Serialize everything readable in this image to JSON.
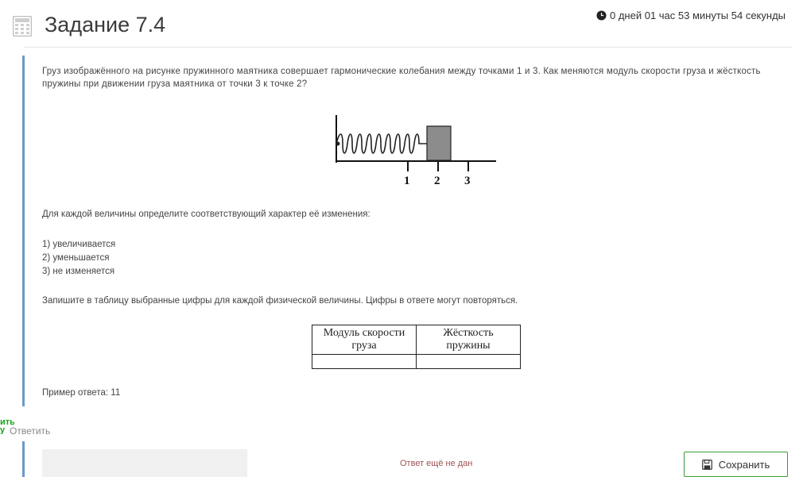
{
  "header": {
    "title": "Задание 7.4",
    "timer": "0 дней 01 час 53 минуты 54 секунды"
  },
  "task": {
    "question": "Груз изображённого на рисунке пружинного маятника совершает гармонические колебания между точками 1 и 3. Как меняются модуль скорости груза и жёсткость пружины при движении груза маятника от точки 3 к точке 2?",
    "figure_labels": [
      "1",
      "2",
      "3"
    ],
    "instruction": "Для каждой величины определите соответствующий характер её изменения:",
    "options": [
      "1) увеличивается",
      "2) уменьшается",
      "3) не изменяется"
    ],
    "table_instruction": "Запишите в таблицу выбранные цифры для каждой физической величины. Цифры в ответе могут повторяться.",
    "table_headers": [
      {
        "line1": "Модуль скорости",
        "line2": "груза"
      },
      {
        "line1": "Жёсткость",
        "line2": "пружины"
      }
    ],
    "example": "Пример ответа: 11"
  },
  "side": {
    "link_text": "ить у",
    "reply_label": "Ответить"
  },
  "answer": {
    "status": "Ответ ещё не дан",
    "save_label": "Сохранить"
  },
  "colors": {
    "accent_border": "#6a9ac6",
    "save_border": "#3a9a3a",
    "status_text": "#a05050"
  }
}
